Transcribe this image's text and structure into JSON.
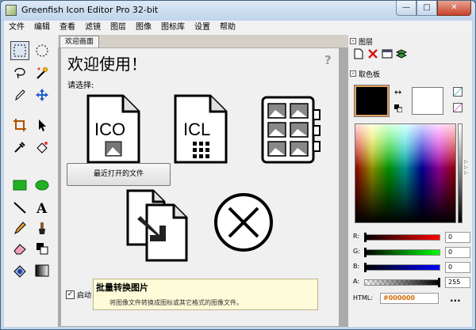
{
  "window": {
    "title": "Greenfish Icon Editor Pro 32-bit",
    "controls": {
      "minimize": "—",
      "maximize": "□",
      "close": "✕"
    }
  },
  "menu": [
    "文件",
    "编辑",
    "查看",
    "滤镜",
    "图层",
    "图像",
    "图标库",
    "设置",
    "帮助"
  ],
  "document_tab": "欢迎画面",
  "welcome": {
    "title": "欢迎使用！",
    "subtitle": "请选择:",
    "help_glyph": "?",
    "ico_label": "ICO",
    "icl_label": "ICL",
    "recent_button": "最近打开的文件",
    "startup_checkbox": {
      "label": "启动",
      "checked": true,
      "mark": "✓"
    },
    "tooltip": {
      "title": "批量转换图片",
      "description": "将图像文件转换成图标或其它格式的图像文件。"
    }
  },
  "panels": {
    "layers": {
      "title": "图层",
      "toggle": "-"
    },
    "color": {
      "title": "取色板",
      "toggle": "-"
    }
  },
  "colors": {
    "foreground": "#000000",
    "background": "#ffffff",
    "channels": [
      {
        "label": "R:",
        "value": "0",
        "fraction": 0.0
      },
      {
        "label": "G:",
        "value": "0",
        "fraction": 0.0
      },
      {
        "label": "B:",
        "value": "0",
        "fraction": 0.0
      },
      {
        "label": "A:",
        "value": "255",
        "fraction": 1.0
      }
    ],
    "html_label": "HTML:",
    "html_value": "#000000",
    "more": "..."
  },
  "icons": {
    "tools": [
      "select-rectangle-icon",
      "select-ellipse-icon",
      "lasso-icon",
      "magic-wand-icon",
      "pencil-icon",
      "move-icon",
      "crop-icon",
      "pointer-icon",
      "eyedropper-icon",
      "fill-icon",
      "rectangle-icon",
      "ellipse-icon",
      "line-icon",
      "text-icon",
      "brush-icon",
      "paintbrush-icon",
      "eraser-icon",
      "color-replace-icon",
      "blur-icon",
      "gradient-icon"
    ]
  }
}
